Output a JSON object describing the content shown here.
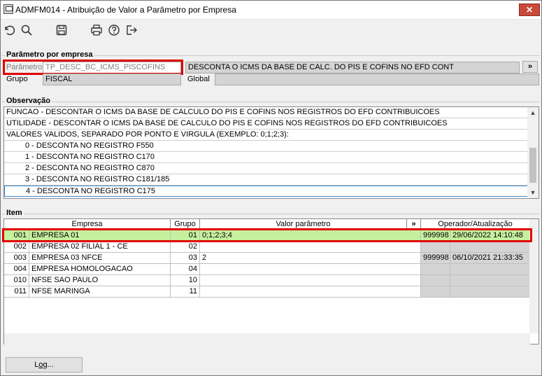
{
  "window": {
    "title": "ADMFM014 - Atribuição de Valor a Parâmetro por Empresa",
    "close_label": "✕"
  },
  "toolbar": {
    "icons": [
      "undo-icon",
      "search-icon",
      "save-icon",
      "print-icon",
      "help-icon",
      "exit-icon"
    ]
  },
  "parametro_section": {
    "title": "Parâmetro por empresa",
    "parametro_label": "Parâmetro",
    "parametro_value": "TP_DESC_BC_ICMS_PISCOFINS",
    "descricao_value": "DESCONTA O ICMS DA BASE DE CALC. DO PIS E COFINS NO EFD CONT",
    "expand_label": "»",
    "grupo_label": "Grupo",
    "grupo_value": "FISCAL",
    "global_label": "Global",
    "global_value": ""
  },
  "observacao": {
    "title": "Observação",
    "lines": [
      "FUNCAO - DESCONTAR O ICMS DA BASE DE CALCULO DO PIS E COFINS NOS REGISTROS DO EFD CONTRIBUICOES",
      "UTILIDADE - DESCONTAR O ICMS DA BASE DE CALCULO DO PIS E COFINS NOS REGISTROS DO EFD CONTRIBUICOES",
      "VALORES VALIDOS, SEPARADO POR PONTO E VIRGULA (EXEMPLO: 0;1;2;3):",
      "0 - DESCONTA NO REGISTRO F550",
      "1 - DESCONTA NO REGISTRO C170",
      "2 - DESCONTA NO REGISTRO C870",
      "3 - DESCONTA NO REGISTRO C181/185",
      "4 - DESCONTA NO REGISTRO C175"
    ]
  },
  "item": {
    "title": "Item",
    "headers": {
      "empresa": "Empresa",
      "grupo": "Grupo",
      "valor": "Valor parâmetro",
      "expand": "»",
      "operador": "Operador/Atualização"
    },
    "rows": [
      {
        "cod": "001",
        "nome": "EMPRESA 01",
        "grupo": "01",
        "valor": "0;1;2;3;4",
        "operador": "999998",
        "data": "29/06/2022 14:10:48"
      },
      {
        "cod": "002",
        "nome": "EMPRESA 02 FILIAL 1 - CE",
        "grupo": "02",
        "valor": "",
        "operador": "",
        "data": ""
      },
      {
        "cod": "003",
        "nome": "EMPRESA 03 NFCE",
        "grupo": "03",
        "valor": "2",
        "operador": "999998",
        "data": "06/10/2021 21:33:35"
      },
      {
        "cod": "004",
        "nome": "EMPRESA HOMOLOGACAO",
        "grupo": "04",
        "valor": "",
        "operador": "",
        "data": ""
      },
      {
        "cod": "010",
        "nome": "NFSE SAO PAULO",
        "grupo": "10",
        "valor": "",
        "operador": "",
        "data": ""
      },
      {
        "cod": "011",
        "nome": "NFSE MARINGA",
        "grupo": "11",
        "valor": "",
        "operador": "",
        "data": ""
      }
    ]
  },
  "log_button": {
    "prefix": "L",
    "underlined": "o",
    "suffix": "g..."
  }
}
